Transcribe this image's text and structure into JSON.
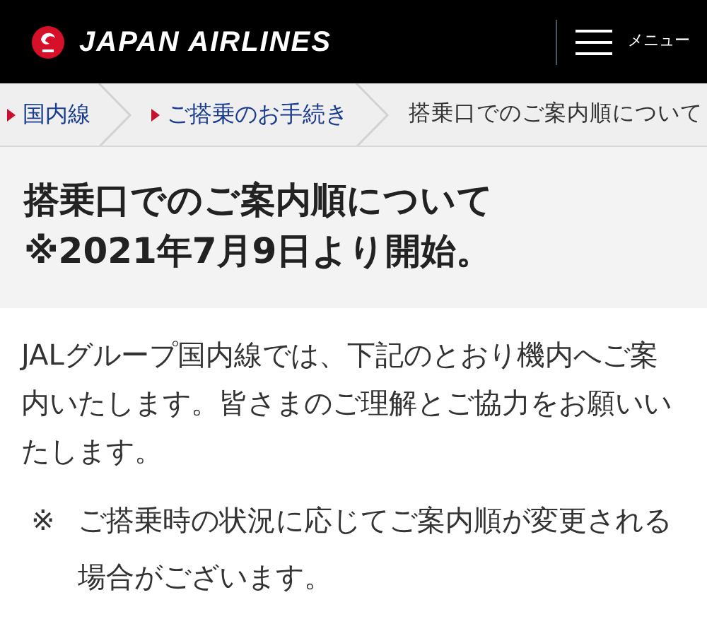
{
  "header": {
    "brand": "JAPAN AIRLINES",
    "menu_label": "メニュー"
  },
  "breadcrumb": [
    {
      "label": "国内線",
      "kind": "link"
    },
    {
      "label": "ご搭乗のお手続き",
      "kind": "link"
    },
    {
      "label": "搭乗口でのご案内順について",
      "kind": "current"
    }
  ],
  "title": [
    "搭乗口でのご案内順について",
    "※2021年7月9日より開始。"
  ],
  "intro": "JALグループ国内線では、下記のとおり機内へご案内いたします。皆さまのご理解とご協力をお願いいたします。",
  "note": {
    "mark": "※",
    "text": "ご搭乗時の状況に応じてご案内順が変更される場合がございます。"
  }
}
